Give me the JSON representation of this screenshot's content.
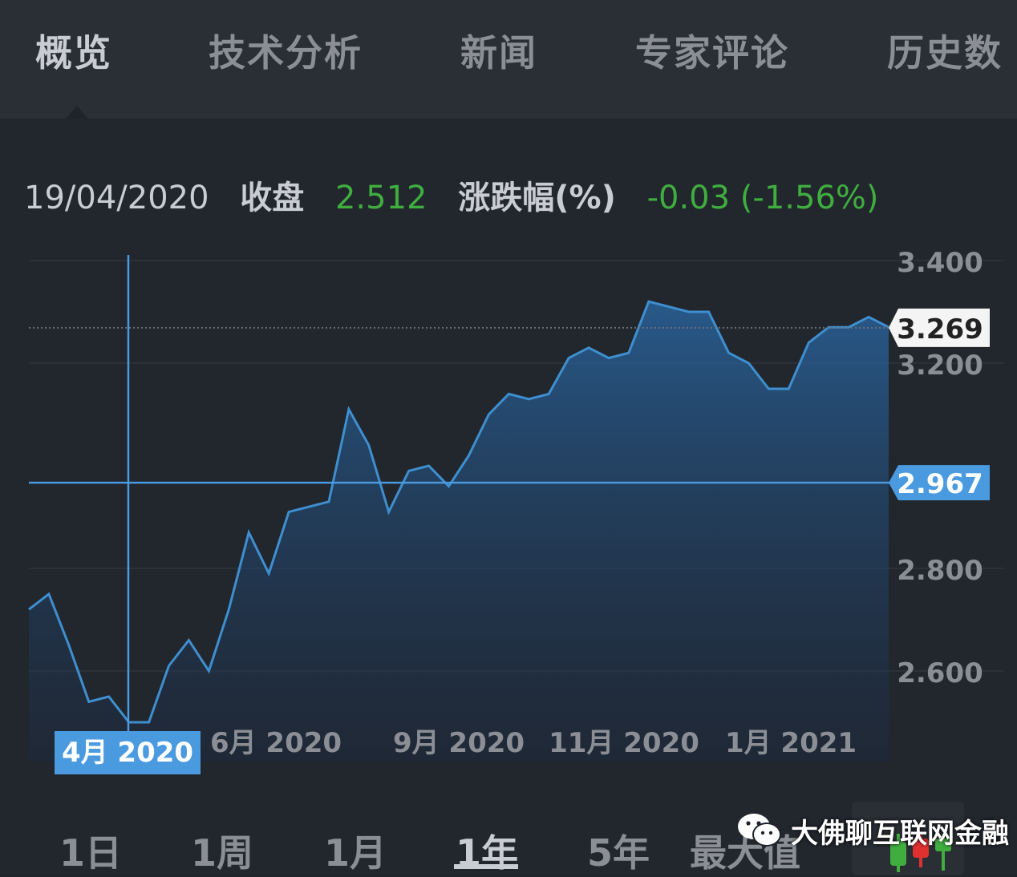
{
  "tabs": [
    {
      "label": "概览",
      "active": true
    },
    {
      "label": "技术分析",
      "active": false
    },
    {
      "label": "新闻",
      "active": false
    },
    {
      "label": "专家评论",
      "active": false
    },
    {
      "label": "历史数",
      "active": false
    }
  ],
  "info": {
    "date": "19/04/2020",
    "close_label": "收盘",
    "close_value": "2.512",
    "change_label": "涨跌幅(%)",
    "change_value": "-0.03 (-1.56%)"
  },
  "colors": {
    "line": "#3e8fd0",
    "highlight": "#4a9ae0",
    "up_green": "#3fae3f",
    "down_red": "#e03030"
  },
  "chart_data": {
    "type": "area",
    "y_ticks": [
      "3.400",
      "3.200",
      "2.800",
      "2.600"
    ],
    "ylim": [
      2.46,
      3.49
    ],
    "x_ticks": [
      "6月 2020",
      "9月 2020",
      "11月 2020",
      "1月 2021"
    ],
    "crosshair": {
      "x_label": "4月 2020",
      "y_label": "2.967"
    },
    "last_price": "3.269",
    "series": [
      {
        "values": [
          2.72,
          2.75,
          2.65,
          2.54,
          2.55,
          2.5,
          2.5,
          2.61,
          2.66,
          2.6,
          2.72,
          2.87,
          2.79,
          2.91,
          2.92,
          2.93,
          3.11,
          3.04,
          2.91,
          2.99,
          3.0,
          2.96,
          3.02,
          3.1,
          3.14,
          3.13,
          3.14,
          3.21,
          3.23,
          3.21,
          3.22,
          3.32,
          3.31,
          3.3,
          3.3,
          3.22,
          3.2,
          3.15,
          3.15,
          3.24,
          3.27,
          3.27,
          3.29,
          3.27
        ]
      }
    ]
  },
  "watermark": {
    "text": "大佛聊互联网金融"
  },
  "ranges": [
    {
      "label": "1日",
      "active": false
    },
    {
      "label": "1周",
      "active": false
    },
    {
      "label": "1月",
      "active": false
    },
    {
      "label": "1年",
      "active": true
    },
    {
      "label": "5年",
      "active": false
    },
    {
      "label": "最大值",
      "active": false
    }
  ]
}
